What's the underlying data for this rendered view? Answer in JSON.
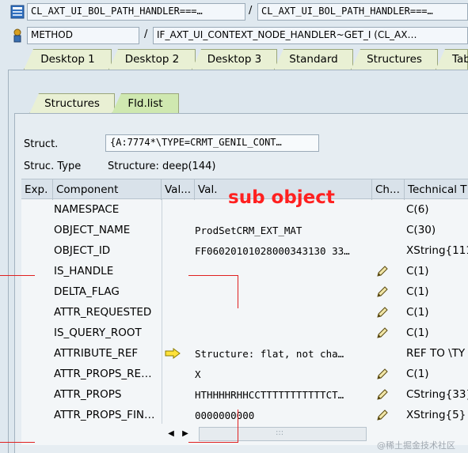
{
  "path_row": {
    "field1": "CL_AXT_UI_BOL_PATH_HANDLER===…",
    "separator": "/",
    "field2": "CL_AXT_UI_BOL_PATH_HANDLER===…"
  },
  "method_row": {
    "label": "METHOD",
    "separator": "/",
    "value": "IF_AXT_UI_CONTEXT_NODE_HANDLER~GET_I (CL_AX…"
  },
  "main_tabs": [
    {
      "label": "Desktop 1"
    },
    {
      "label": "Desktop 2"
    },
    {
      "label": "Desktop 3"
    },
    {
      "label": "Standard"
    },
    {
      "label": "Structures"
    },
    {
      "label": "Tab"
    }
  ],
  "inner_tabs": [
    {
      "label": "Structures"
    },
    {
      "label": "Fld.list"
    }
  ],
  "struct": {
    "label": "Struct.",
    "value": "{A:7774*\\TYPE=CRMT_GENIL_CONT…",
    "type_label": "Struc. Type",
    "type_value": "Structure: deep(144)"
  },
  "grid": {
    "headers": [
      "Exp.",
      "Component",
      "Val...",
      "Val.",
      "Ch...",
      "Technical T"
    ],
    "rows": [
      {
        "component": "NAMESPACE",
        "value": "",
        "tech": "C(6)",
        "edit": false,
        "arrow": false
      },
      {
        "component": "OBJECT_NAME",
        "value": "ProdSetCRM_EXT_MAT",
        "tech": "C(30)",
        "edit": false,
        "arrow": false
      },
      {
        "component": "OBJECT_ID",
        "value": "FF06020101028000343130 33…",
        "tech": "XString{111",
        "edit": false,
        "arrow": false
      },
      {
        "component": "IS_HANDLE",
        "value": "",
        "tech": "C(1)",
        "edit": true,
        "arrow": false
      },
      {
        "component": "DELTA_FLAG",
        "value": "",
        "tech": "C(1)",
        "edit": true,
        "arrow": false
      },
      {
        "component": "ATTR_REQUESTED",
        "value": "",
        "tech": "C(1)",
        "edit": true,
        "arrow": false
      },
      {
        "component": "IS_QUERY_ROOT",
        "value": "",
        "tech": "C(1)",
        "edit": true,
        "arrow": false
      },
      {
        "component": "ATTRIBUTE_REF",
        "value": "Structure: flat, not cha…",
        "tech": "REF TO \\TY",
        "edit": false,
        "arrow": true
      },
      {
        "component": "ATTR_PROPS_RE…",
        "value": "X",
        "tech": "C(1)",
        "edit": true,
        "arrow": false
      },
      {
        "component": "ATTR_PROPS",
        "value": "HTHHHHRHHCCTTTTTTTTTTTCT…",
        "tech": "CString{33}",
        "edit": true,
        "arrow": false
      },
      {
        "component": "ATTR_PROPS_FIN…",
        "value": "0000000000",
        "tech": "XString{5}",
        "edit": true,
        "arrow": false
      }
    ],
    "scroll_grip": ":::"
  },
  "annotation": "sub object",
  "watermark": "@稀土掘金技术社区",
  "icons": {
    "class": "class-icon",
    "method": "method-icon",
    "edit": "pencil-icon",
    "arrow": "arrow-right-icon"
  },
  "colors": {
    "annotation": "#ff2020",
    "tab_bg": "#e9f0d4",
    "pane_bg": "#dde7ee"
  }
}
